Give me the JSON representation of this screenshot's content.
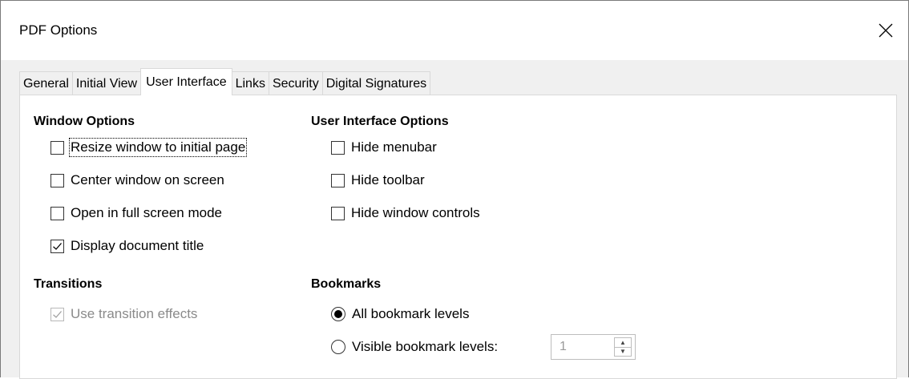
{
  "window": {
    "title": "PDF Options",
    "close_icon": "close-icon"
  },
  "tabs": [
    {
      "label": "General"
    },
    {
      "label": "Initial View"
    },
    {
      "label": "User Interface",
      "active": true
    },
    {
      "label": "Links"
    },
    {
      "label": "Security"
    },
    {
      "label": "Digital Signatures"
    }
  ],
  "window_options": {
    "title": "Window Options",
    "items": [
      {
        "label": "Resize window to initial page",
        "checked": false
      },
      {
        "label": "Center window on screen",
        "checked": false
      },
      {
        "label": "Open in full screen mode",
        "checked": false
      },
      {
        "label": "Display document title",
        "checked": true
      }
    ]
  },
  "ui_options": {
    "title": "User Interface Options",
    "items": [
      {
        "label": "Hide menubar",
        "checked": false
      },
      {
        "label": "Hide toolbar",
        "checked": false
      },
      {
        "label": "Hide window controls",
        "checked": false
      }
    ]
  },
  "transitions": {
    "title": "Transitions",
    "items": [
      {
        "label": "Use transition effects",
        "checked": true,
        "disabled": true
      }
    ]
  },
  "bookmarks": {
    "title": "Bookmarks",
    "all_label": "All bookmark levels",
    "visible_label": "Visible bookmark levels:",
    "selected": "all",
    "visible_value": "1"
  },
  "colors": {
    "dialog_bg": "#f0f0f0",
    "panel_bg": "#ffffff",
    "border": "#d9d9d9",
    "disabled_text": "#8a8a8a"
  }
}
